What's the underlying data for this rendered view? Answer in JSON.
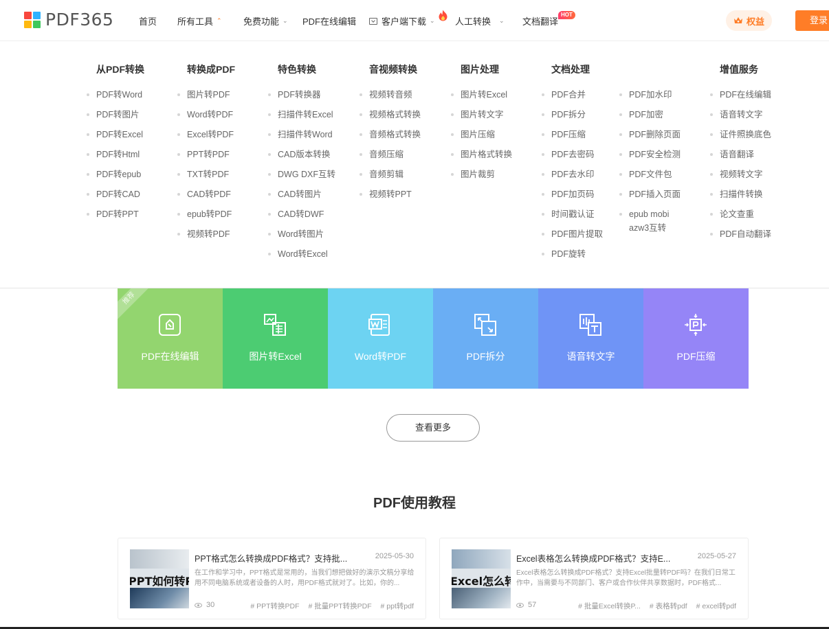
{
  "brand": {
    "name": "PDF365",
    "colors": [
      "#f8473d",
      "#2eb2ff",
      "#ffb90f",
      "#3ec85c"
    ]
  },
  "nav": {
    "items": [
      {
        "label": "首页",
        "has_dropdown": false
      },
      {
        "label": "所有工具",
        "has_dropdown": true,
        "expanded": true
      },
      {
        "label": "免费功能",
        "has_dropdown": true
      },
      {
        "label": "PDF在线编辑",
        "has_dropdown": false
      },
      {
        "label": "客户端下载",
        "has_dropdown": true,
        "icon": "download-icon"
      },
      {
        "label": "人工转换",
        "has_dropdown": true,
        "icon": "flame-icon"
      },
      {
        "label": "文档翻译",
        "has_dropdown": false,
        "badge": "HOT"
      }
    ],
    "chevron_down": "⌄",
    "chevron_up": "⌃",
    "quanyi_label": "权益",
    "login_label": "登录",
    "accent": "#ff7d27"
  },
  "mega_menu": {
    "columns": [
      {
        "title": "从PDF转换",
        "items": [
          "PDF转Word",
          "PDF转图片",
          "PDF转Excel",
          "PDF转Html",
          "PDF转epub",
          "PDF转CAD",
          "PDF转PPT"
        ]
      },
      {
        "title": "转换成PDF",
        "items": [
          "图片转PDF",
          "Word转PDF",
          "Excel转PDF",
          "PPT转PDF",
          "TXT转PDF",
          "CAD转PDF",
          "epub转PDF",
          "视频转PDF"
        ]
      },
      {
        "title": "特色转换",
        "items": [
          "PDF转换器",
          "扫描件转Excel",
          "扫描件转Word",
          "CAD版本转换",
          "DWG DXF互转",
          "CAD转图片",
          "CAD转DWF",
          "Word转图片",
          "Word转Excel"
        ]
      },
      {
        "title": "音视频转换",
        "items": [
          "视频转音频",
          "视频格式转换",
          "音频格式转换",
          "音频压缩",
          "音频剪辑",
          "视频转PPT"
        ]
      },
      {
        "title": "图片处理",
        "items": [
          "图片转Excel",
          "图片转文字",
          "图片压缩",
          "图片格式转换",
          "图片裁剪"
        ]
      },
      {
        "title": "文档处理",
        "items": [
          "PDF合并",
          "PDF拆分",
          "PDF压缩",
          "PDF去密码",
          "PDF去水印",
          "PDF加页码",
          "时间戳认证",
          "PDF图片提取",
          "PDF旋转"
        ]
      },
      {
        "title": "",
        "items": [
          "PDF加水印",
          "PDF加密",
          "PDF删除页面",
          "PDF安全检测",
          "PDF文件包",
          "PDF插入页面",
          "epub mobi azw3互转"
        ]
      },
      {
        "title": "增值服务",
        "items": [
          "PDF在线编辑",
          "语音转文字",
          "证件照换底色",
          "语音翻译",
          "视频转文字",
          "扫描件转换",
          "论文查重",
          "PDF自动翻译"
        ]
      }
    ]
  },
  "tiles": [
    {
      "label": "PDF在线编辑",
      "color": "#93d56f",
      "icon": "edit-icon",
      "ribbon": "推荐"
    },
    {
      "label": "图片转Excel",
      "color": "#4ccc72",
      "icon": "image-excel-icon"
    },
    {
      "label": "Word转PDF",
      "color": "#6dd3f2",
      "icon": "word-icon"
    },
    {
      "label": "PDF拆分",
      "color": "#6aaef4",
      "icon": "split-icon"
    },
    {
      "label": "语音转文字",
      "color": "#6f94f6",
      "icon": "voice-text-icon"
    },
    {
      "label": "PDF压缩",
      "color": "#9585f7",
      "icon": "compress-icon"
    }
  ],
  "more_button": "查看更多",
  "tutorial": {
    "title": "PDF使用教程",
    "articles": [
      {
        "thumb_text": "PPT如何转PDF",
        "title": "PPT格式怎么转换成PDF格式？支持批...",
        "date": "2025-05-30",
        "desc": "在工作和学习中，PPT格式是常用的，当我们想把做好的演示文稿分享给用不同电脑系统或者设备的人时，用PDF格式就对了。比如，你的...",
        "views": "30",
        "tags": [
          "# PPT转换PDF",
          "# 批量PPT转换PDF",
          "# ppt转pdf"
        ]
      },
      {
        "thumb_text": "Excel怎么转PDF",
        "title": "Excel表格怎么转换成PDF格式？支持E...",
        "date": "2025-05-27",
        "desc": "Excel表格怎么转换成PDF格式？支持Excel批量转PDF吗？在我们日常工作中，当需要与不同部门、客户或合作伙伴共享数据时，PDF格式...",
        "views": "57",
        "tags": [
          "# 批量Excel转换P...",
          "# 表格转pdf",
          "# excel转pdf"
        ]
      }
    ]
  }
}
